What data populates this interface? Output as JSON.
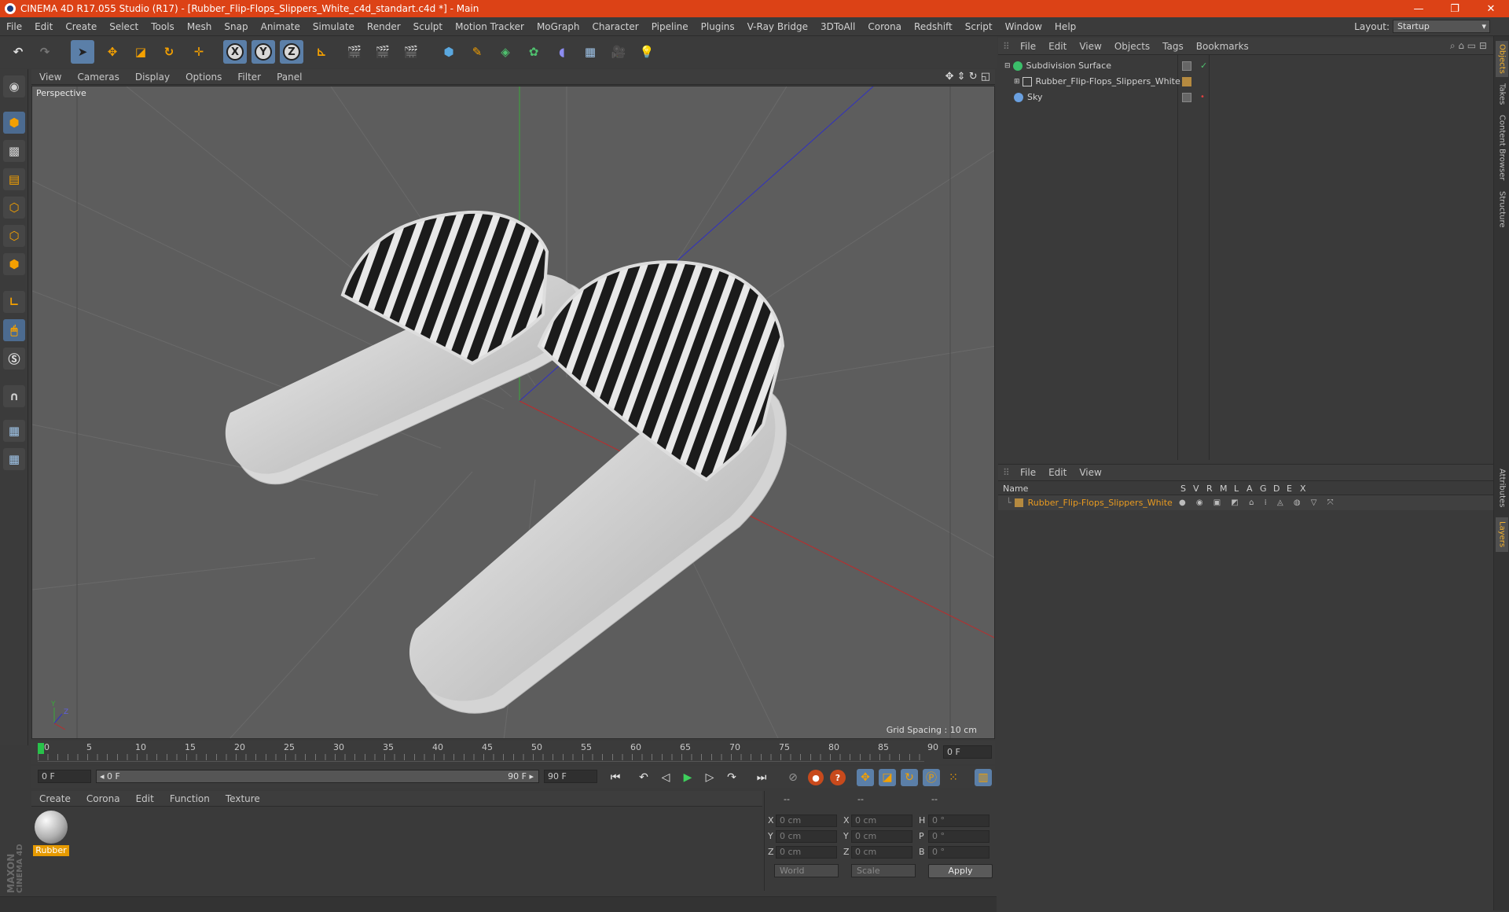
{
  "window": {
    "title": "CINEMA 4D R17.055 Studio (R17) - [Rubber_Flip-Flops_Slippers_White_c4d_standart.c4d *] - Main",
    "minimize": "—",
    "restore": "❐",
    "close": "✕"
  },
  "menubar": {
    "items": [
      "File",
      "Edit",
      "Create",
      "Select",
      "Tools",
      "Mesh",
      "Snap",
      "Animate",
      "Simulate",
      "Render",
      "Sculpt",
      "Motion Tracker",
      "MoGraph",
      "Character",
      "Pipeline",
      "Plugins",
      "V-Ray Bridge",
      "3DToAll",
      "Corona",
      "Redshift",
      "Script",
      "Window",
      "Help"
    ],
    "layout_label": "Layout:",
    "layout_value": "Startup"
  },
  "toolbar": {
    "x_label": "X",
    "y_label": "Y",
    "z_label": "Z"
  },
  "viewport": {
    "menu": [
      "View",
      "Cameras",
      "Display",
      "Options",
      "Filter",
      "Panel"
    ],
    "label": "Perspective",
    "grid_spacing": "Grid Spacing : 10 cm"
  },
  "timeline": {
    "ticks": [
      "0",
      "5",
      "10",
      "15",
      "20",
      "25",
      "30",
      "35",
      "40",
      "45",
      "50",
      "55",
      "60",
      "65",
      "70",
      "75",
      "80",
      "85",
      "90"
    ],
    "current_frame": "0 F"
  },
  "playbar": {
    "start_field": "0 F",
    "range_start": "◂ 0 F",
    "range_end": "90 F ▸",
    "end_field": "90 F"
  },
  "material_manager": {
    "menu": [
      "Create",
      "Corona",
      "Edit",
      "Function",
      "Texture"
    ],
    "materials": [
      {
        "name": "Rubber"
      }
    ]
  },
  "coordinates": {
    "header": [
      "--",
      "--",
      "--"
    ],
    "rows": [
      {
        "a": "X",
        "v1": "0 cm",
        "b": "X",
        "v2": "0 cm",
        "c": "H",
        "v3": "0 °"
      },
      {
        "a": "Y",
        "v1": "0 cm",
        "b": "Y",
        "v2": "0 cm",
        "c": "P",
        "v3": "0 °"
      },
      {
        "a": "Z",
        "v1": "0 cm",
        "b": "Z",
        "v2": "0 cm",
        "c": "B",
        "v3": "0 °"
      }
    ],
    "world": "World",
    "scale": "Scale",
    "apply": "Apply"
  },
  "object_manager": {
    "menu": [
      "File",
      "Edit",
      "View",
      "Objects",
      "Tags",
      "Bookmarks"
    ],
    "objects": [
      {
        "name": "Subdivision Surface",
        "check": "✓"
      },
      {
        "name": "Rubber_Flip-Flops_Slippers_White",
        "check": ""
      },
      {
        "name": "Sky",
        "check": ""
      }
    ]
  },
  "layer_manager": {
    "menu": [
      "File",
      "Edit",
      "View"
    ],
    "columns": [
      "Name",
      "S",
      "V",
      "R",
      "M",
      "L",
      "A",
      "G",
      "D",
      "E",
      "X"
    ],
    "layers": [
      {
        "name": "Rubber_Flip-Flops_Slippers_White"
      }
    ]
  },
  "right_tabs": [
    "Objects",
    "Takes",
    "Content Browser",
    "Structure",
    "Attributes",
    "Layers"
  ],
  "branding": {
    "maxon": "MAXON",
    "c4d": "CINEMA 4D"
  },
  "colors": {
    "titlebar": "#dc4216",
    "accent_orange": "#f4a000",
    "layer_name": "#e89a20",
    "active_tool": "#5b7fa8"
  }
}
